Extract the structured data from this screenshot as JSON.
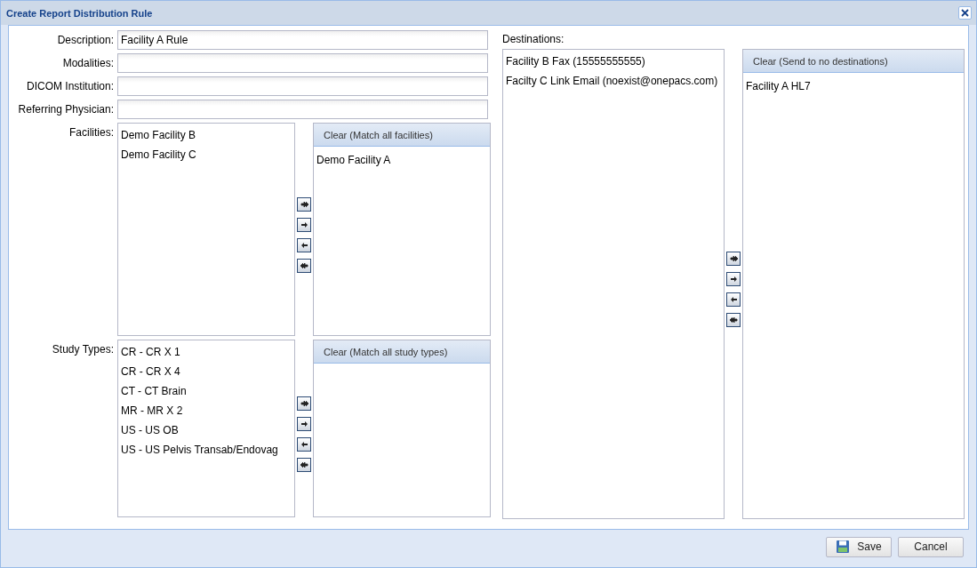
{
  "window": {
    "title": "Create Report Distribution Rule"
  },
  "fields": [
    {
      "label": "Description:",
      "value": "Facility A Rule"
    },
    {
      "label": "Modalities:"
    },
    {
      "label": "DICOM Institution:"
    },
    {
      "label": "Referring Physician:"
    }
  ],
  "pickers": [
    {
      "label": "Facilities:",
      "available": [
        "Demo Facility B",
        "Demo Facility C"
      ],
      "clear_button": "Clear (Match all facilities)",
      "chosen": [
        "Demo Facility A"
      ]
    },
    {
      "label": "Study Types:",
      "available": [
        "CR - CR X 1",
        "CR - CR X 4",
        "CT - CT Brain",
        "MR - MR X 2",
        "US - US OB",
        "US - US Pelvis Transab/Endovag"
      ],
      "clear_button": "Clear (Match all study types)"
    }
  ],
  "destinations": {
    "label": "Destinations:",
    "available": [
      "Facility B Fax (15555555555)",
      "Facilty C Link Email (noexist@onepacs.com)"
    ],
    "clear_button": "Clear (Send to no destinations)",
    "chosen": [
      "Facility A HL7"
    ]
  },
  "buttons": [
    {
      "label": "Save",
      "kind": "save"
    },
    {
      "label": "Cancel",
      "kind": "plain"
    }
  ]
}
